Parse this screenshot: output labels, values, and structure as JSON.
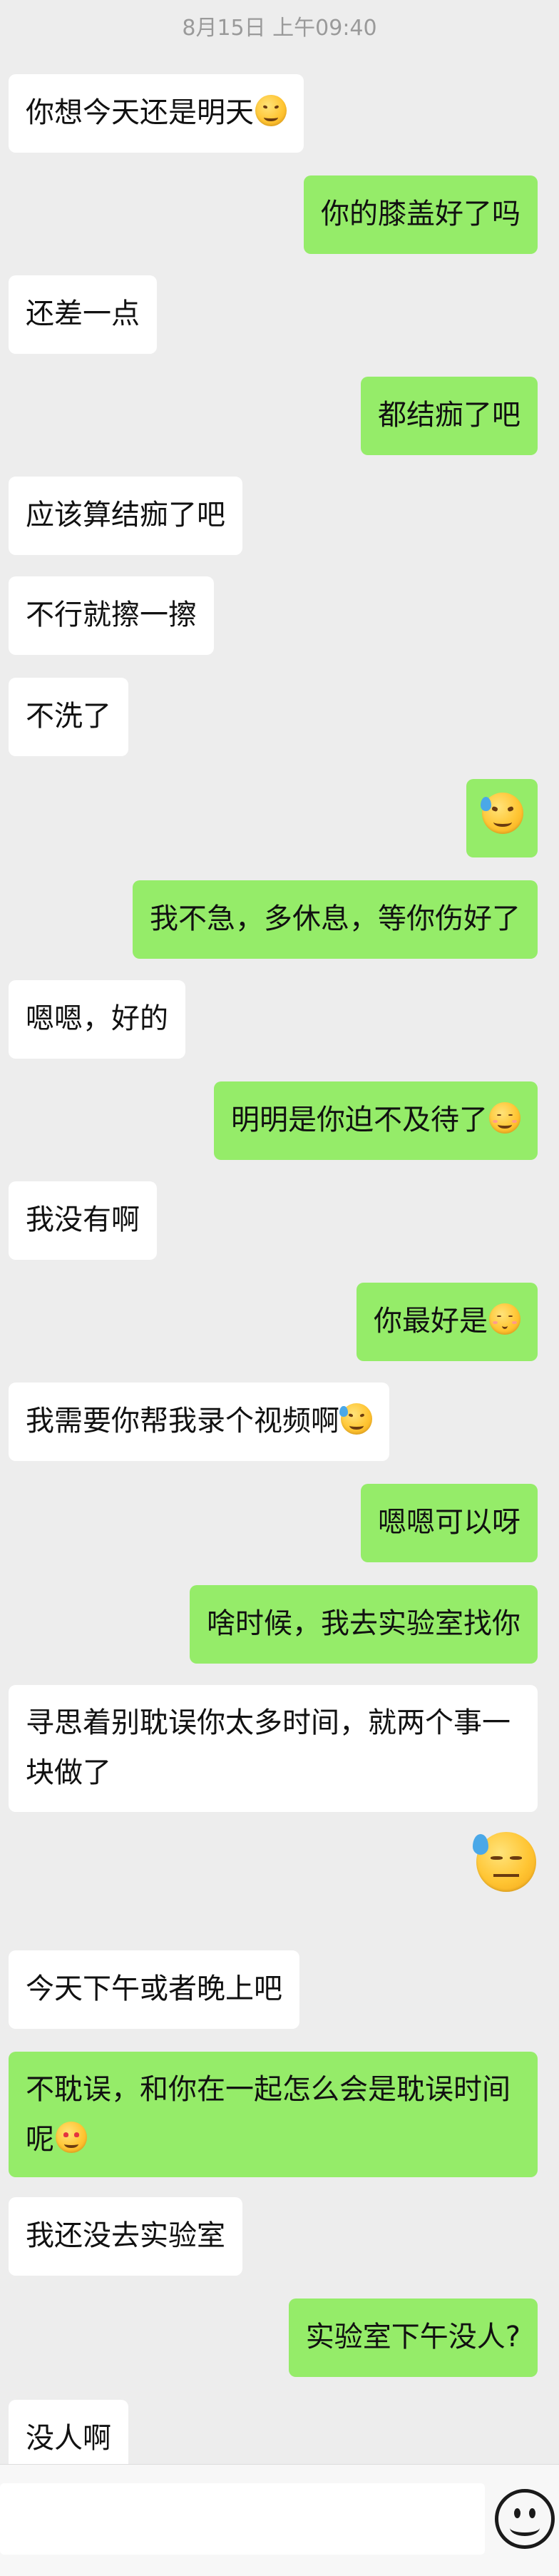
{
  "timestamp": "8月15日 上午09:40",
  "messages": [
    {
      "side": "left",
      "text": "你想今天还是明天",
      "emoji": "grin-squint-icon"
    },
    {
      "side": "right",
      "text": "你的膝盖好了吗"
    },
    {
      "side": "left",
      "text": "还差一点"
    },
    {
      "side": "right",
      "text": "都结痂了吧"
    },
    {
      "side": "left",
      "text": "应该算结痂了吧"
    },
    {
      "side": "left",
      "text": "不行就擦一擦"
    },
    {
      "side": "left",
      "text": "不洗了"
    },
    {
      "side": "right",
      "text": "",
      "emoji": "laugh-cry-icon"
    },
    {
      "side": "right",
      "text": "我不急，多休息，等你伤好了"
    },
    {
      "side": "left",
      "text": "嗯嗯，好的"
    },
    {
      "side": "right",
      "text": "明明是你迫不及待了",
      "emoji": "smile-blush-icon"
    },
    {
      "side": "left",
      "text": "我没有啊"
    },
    {
      "side": "right",
      "text": "你最好是",
      "emoji": "kiss-icon"
    },
    {
      "side": "left",
      "text": "我需要你帮我录个视频啊",
      "emoji": "laugh-cry-icon"
    },
    {
      "side": "right",
      "text": "嗯嗯可以呀"
    },
    {
      "side": "right",
      "text": "啥时候，我去实验室找你"
    },
    {
      "side": "left",
      "text": "寻思着别耽误你太多时间，就两个事一块做了"
    },
    {
      "side": "right",
      "text": "",
      "emoji": "sweat-icon",
      "standalone": true
    },
    {
      "side": "left",
      "text": "今天下午或者晚上吧"
    },
    {
      "side": "right",
      "text": "不耽误，和你在一起怎么会是耽误时间呢",
      "emoji": "heart-eyes-icon"
    },
    {
      "side": "left",
      "text": "我还没去实验室"
    },
    {
      "side": "right",
      "text": "实验室下午没人?"
    },
    {
      "side": "left",
      "text": "没人啊"
    }
  ],
  "input": {
    "value": "",
    "placeholder": ""
  },
  "emoji_button_icon": "smiley-face-icon"
}
